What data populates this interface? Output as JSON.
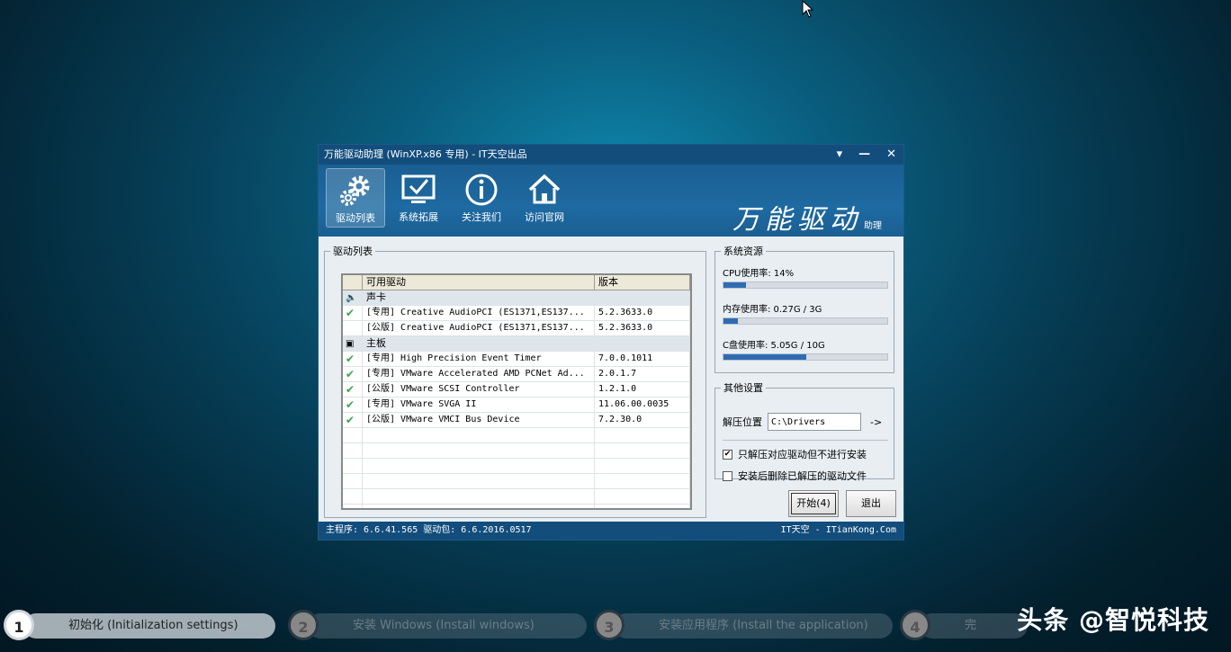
{
  "window": {
    "title": "万能驱动助理 (WinXP.x86 专用) - IT天空出品",
    "controls": [
      "▾",
      "—",
      "✕"
    ],
    "toolbar": [
      {
        "label": "驱动列表",
        "icon": "gear-icon",
        "active": true
      },
      {
        "label": "系统拓展",
        "icon": "monitor-check-icon",
        "active": false
      },
      {
        "label": "关注我们",
        "icon": "info-icon",
        "active": false
      },
      {
        "label": "访问官网",
        "icon": "home-icon",
        "active": false
      }
    ],
    "brand": "万能驱动",
    "brand_sub": "助理"
  },
  "drivers": {
    "group_title": "驱动列表",
    "columns": [
      "可用驱动",
      "版本"
    ],
    "rows": [
      {
        "type": "category",
        "icon": "speaker-icon",
        "name": "声卡",
        "version": ""
      },
      {
        "type": "item",
        "checked": true,
        "name": "[专用] Creative AudioPCI (ES1371,ES137...",
        "version": "5.2.3633.0"
      },
      {
        "type": "item",
        "checked": false,
        "name": "[公版] Creative AudioPCI (ES1371,ES137...",
        "version": "5.2.3633.0"
      },
      {
        "type": "category",
        "icon": "chip-icon",
        "name": "主板",
        "version": ""
      },
      {
        "type": "item",
        "checked": true,
        "name": "[专用] High Precision Event Timer",
        "version": "7.0.0.1011"
      },
      {
        "type": "item",
        "checked": true,
        "name": "[专用] VMware Accelerated AMD PCNet Ad...",
        "version": "2.0.1.7"
      },
      {
        "type": "item",
        "checked": true,
        "name": "[公版] VMware SCSI Controller",
        "version": "1.2.1.0"
      },
      {
        "type": "item",
        "checked": true,
        "name": "[专用] VMware SVGA II",
        "version": "11.06.00.0035"
      },
      {
        "type": "item",
        "checked": true,
        "name": "[公版] VMware VMCI Bus Device",
        "version": "7.2.30.0"
      }
    ],
    "empty_rows": 6
  },
  "resources": {
    "group_title": "系统资源",
    "items": [
      {
        "label": "CPU使用率:  14%",
        "fraction": 0.14
      },
      {
        "label": "内存使用率: 0.27G / 3G",
        "fraction": 0.09
      },
      {
        "label": "C盘使用率:  5.05G / 10G",
        "fraction": 0.505
      }
    ]
  },
  "other": {
    "group_title": "其他设置",
    "path_label": "解压位置",
    "path_value": "C:\\Drivers",
    "path_arrow": "->",
    "options": [
      {
        "label": "只解压对应驱动但不进行安装",
        "checked": true
      },
      {
        "label": "安装后删除已解压的驱动文件",
        "checked": false
      }
    ]
  },
  "buttons": {
    "start": "开始(4)",
    "exit": "退出"
  },
  "status": {
    "left": "主程序: 6.6.41.565    驱动包: 6.6.2016.0517",
    "right": "IT天空 - ITianKong.Com"
  },
  "steps": [
    {
      "num": "1",
      "label": "初始化 (Initialization settings)",
      "active": true
    },
    {
      "num": "2",
      "label": "安装 Windows (Install windows)",
      "active": false
    },
    {
      "num": "3",
      "label": "安装应用程序 (Install the application)",
      "active": false
    },
    {
      "num": "4",
      "label": "完",
      "active": false
    }
  ],
  "watermark": "头条 @智悦科技",
  "colors": {
    "accent": "#124d7c",
    "bar_fill": "#2f6bb3",
    "check": "#3aa34a"
  }
}
